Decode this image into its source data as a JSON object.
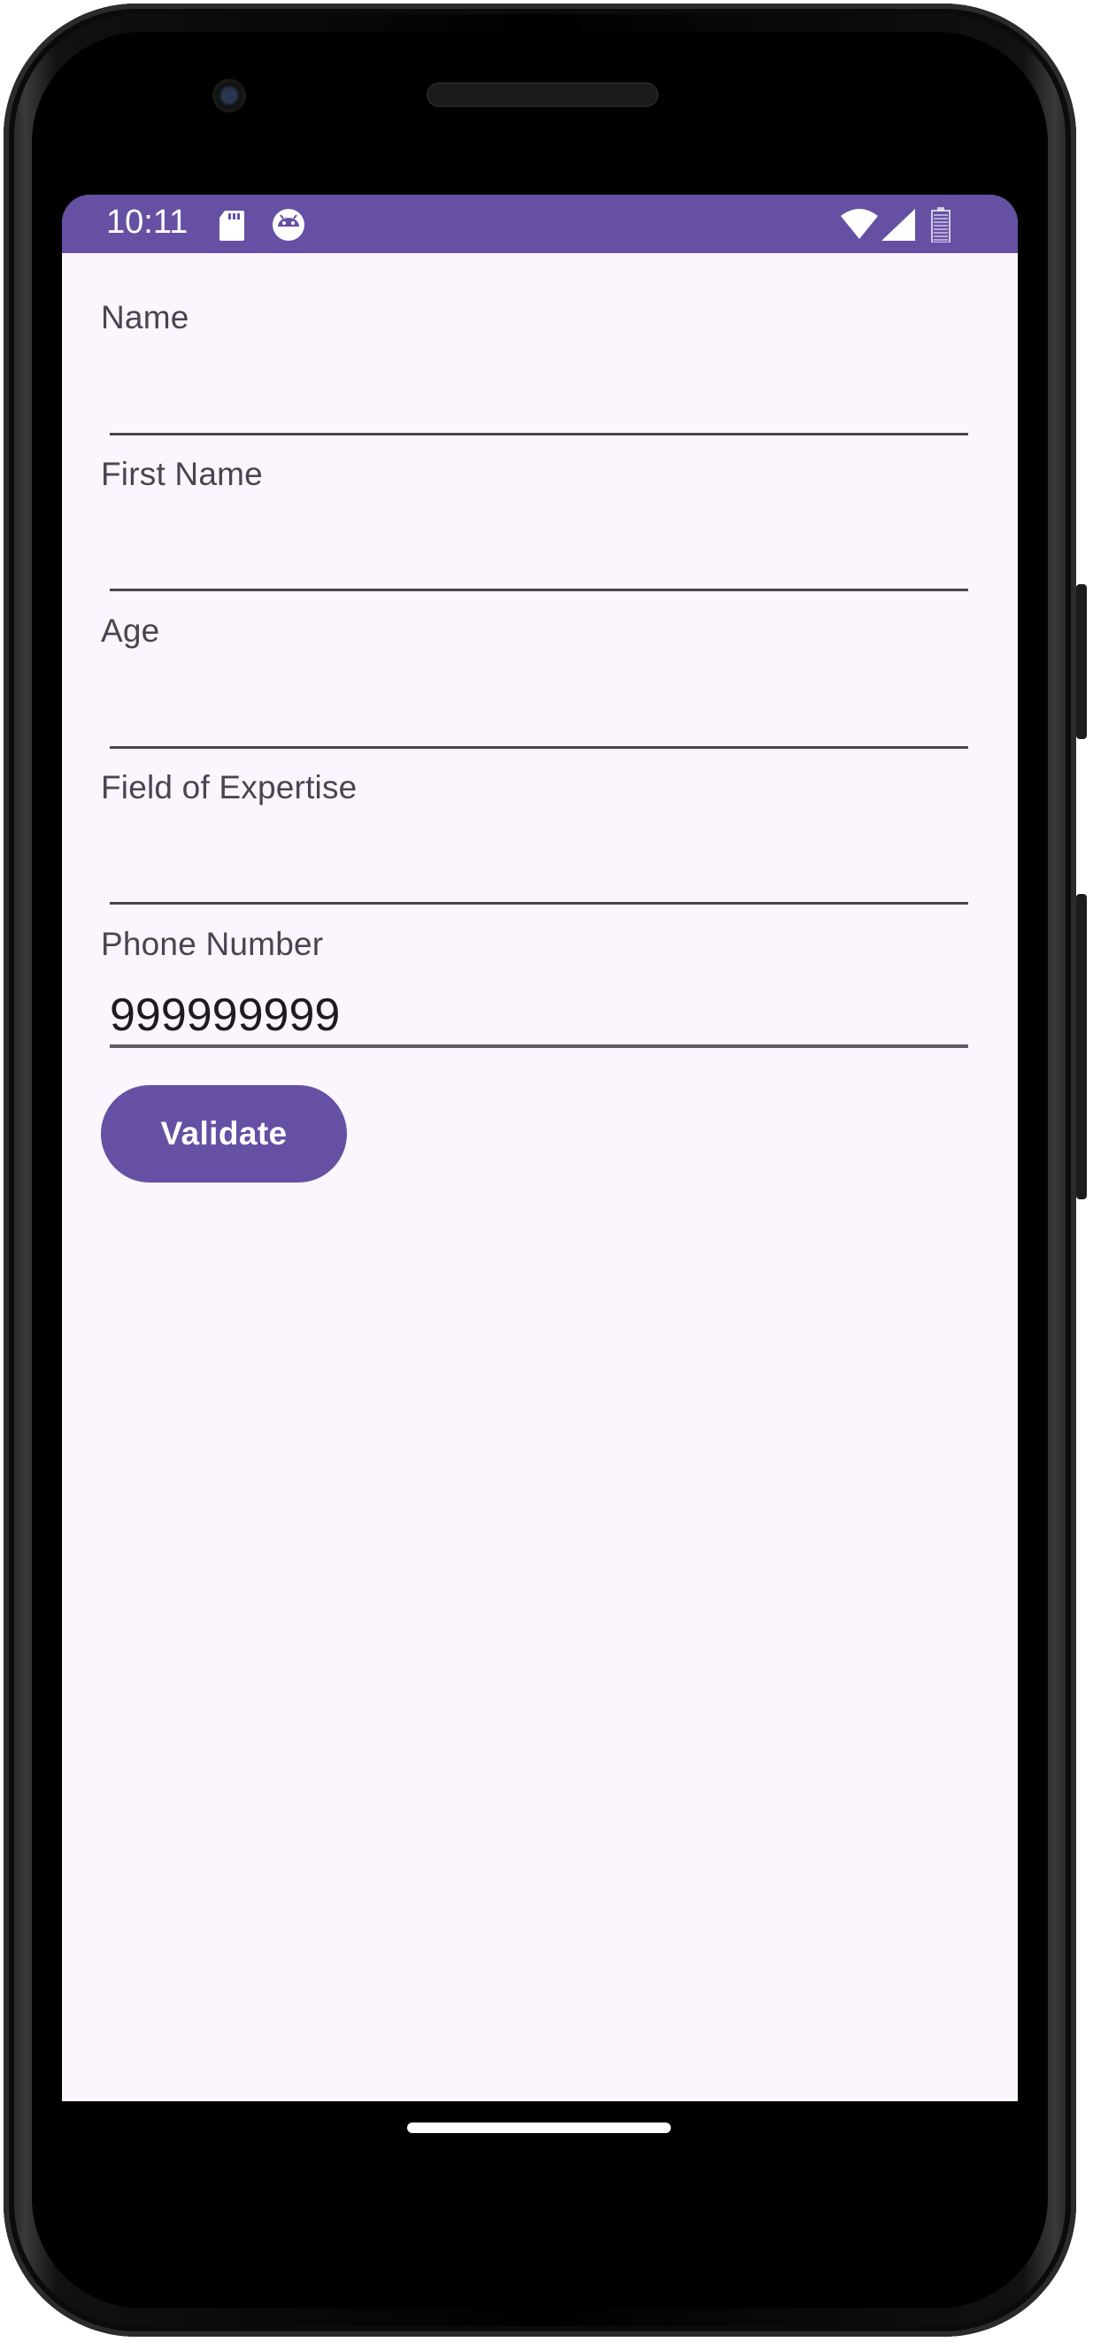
{
  "status_bar": {
    "time": "10:11",
    "icons": [
      "sd-card-icon",
      "robot-notification-icon",
      "wifi-icon",
      "cell-signal-icon",
      "battery-icon"
    ]
  },
  "form": {
    "fields": [
      {
        "label": "Name",
        "value": ""
      },
      {
        "label": "First Name",
        "value": ""
      },
      {
        "label": "Age",
        "value": ""
      },
      {
        "label": "Field of Expertise",
        "value": ""
      },
      {
        "label": "Phone Number",
        "value": "999999999"
      }
    ],
    "validate_label": "Validate"
  },
  "colors": {
    "primary": "#6650a4",
    "background": "#fbf5fd",
    "label_text": "#49454f",
    "input_text": "#1d1b20"
  }
}
